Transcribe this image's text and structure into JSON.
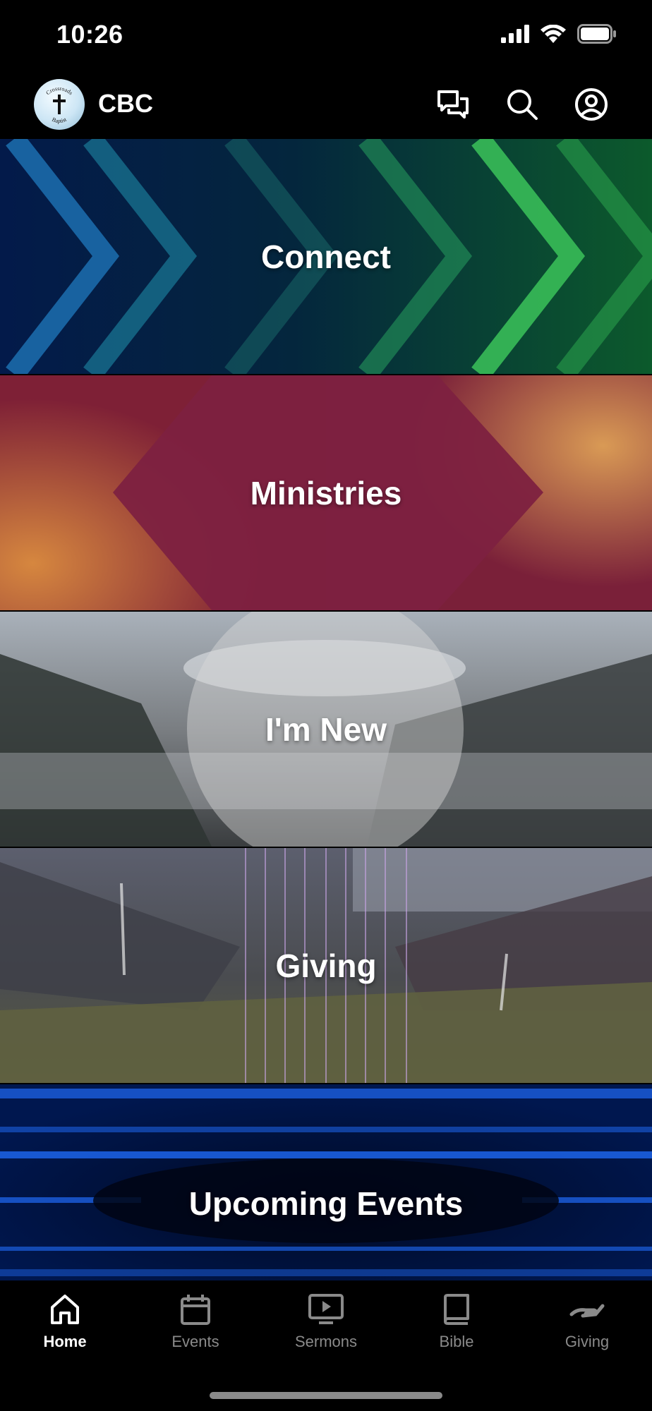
{
  "status_bar": {
    "time": "10:26"
  },
  "header": {
    "logo_text_top": "Crossroads",
    "logo_text_bottom": "Baptist",
    "title": "CBC",
    "icons": [
      "messages-icon",
      "search-icon",
      "profile-icon"
    ]
  },
  "tiles": [
    {
      "label": "Connect"
    },
    {
      "label": "Ministries"
    },
    {
      "label": "I'm New"
    },
    {
      "label": "Giving"
    },
    {
      "label": "Upcoming Events"
    }
  ],
  "tab_bar": {
    "active": "Home",
    "tabs": [
      {
        "label": "Home",
        "icon": "home-icon"
      },
      {
        "label": "Events",
        "icon": "calendar-icon"
      },
      {
        "label": "Sermons",
        "icon": "video-icon"
      },
      {
        "label": "Bible",
        "icon": "book-icon"
      },
      {
        "label": "Giving",
        "icon": "giving-icon"
      }
    ]
  }
}
